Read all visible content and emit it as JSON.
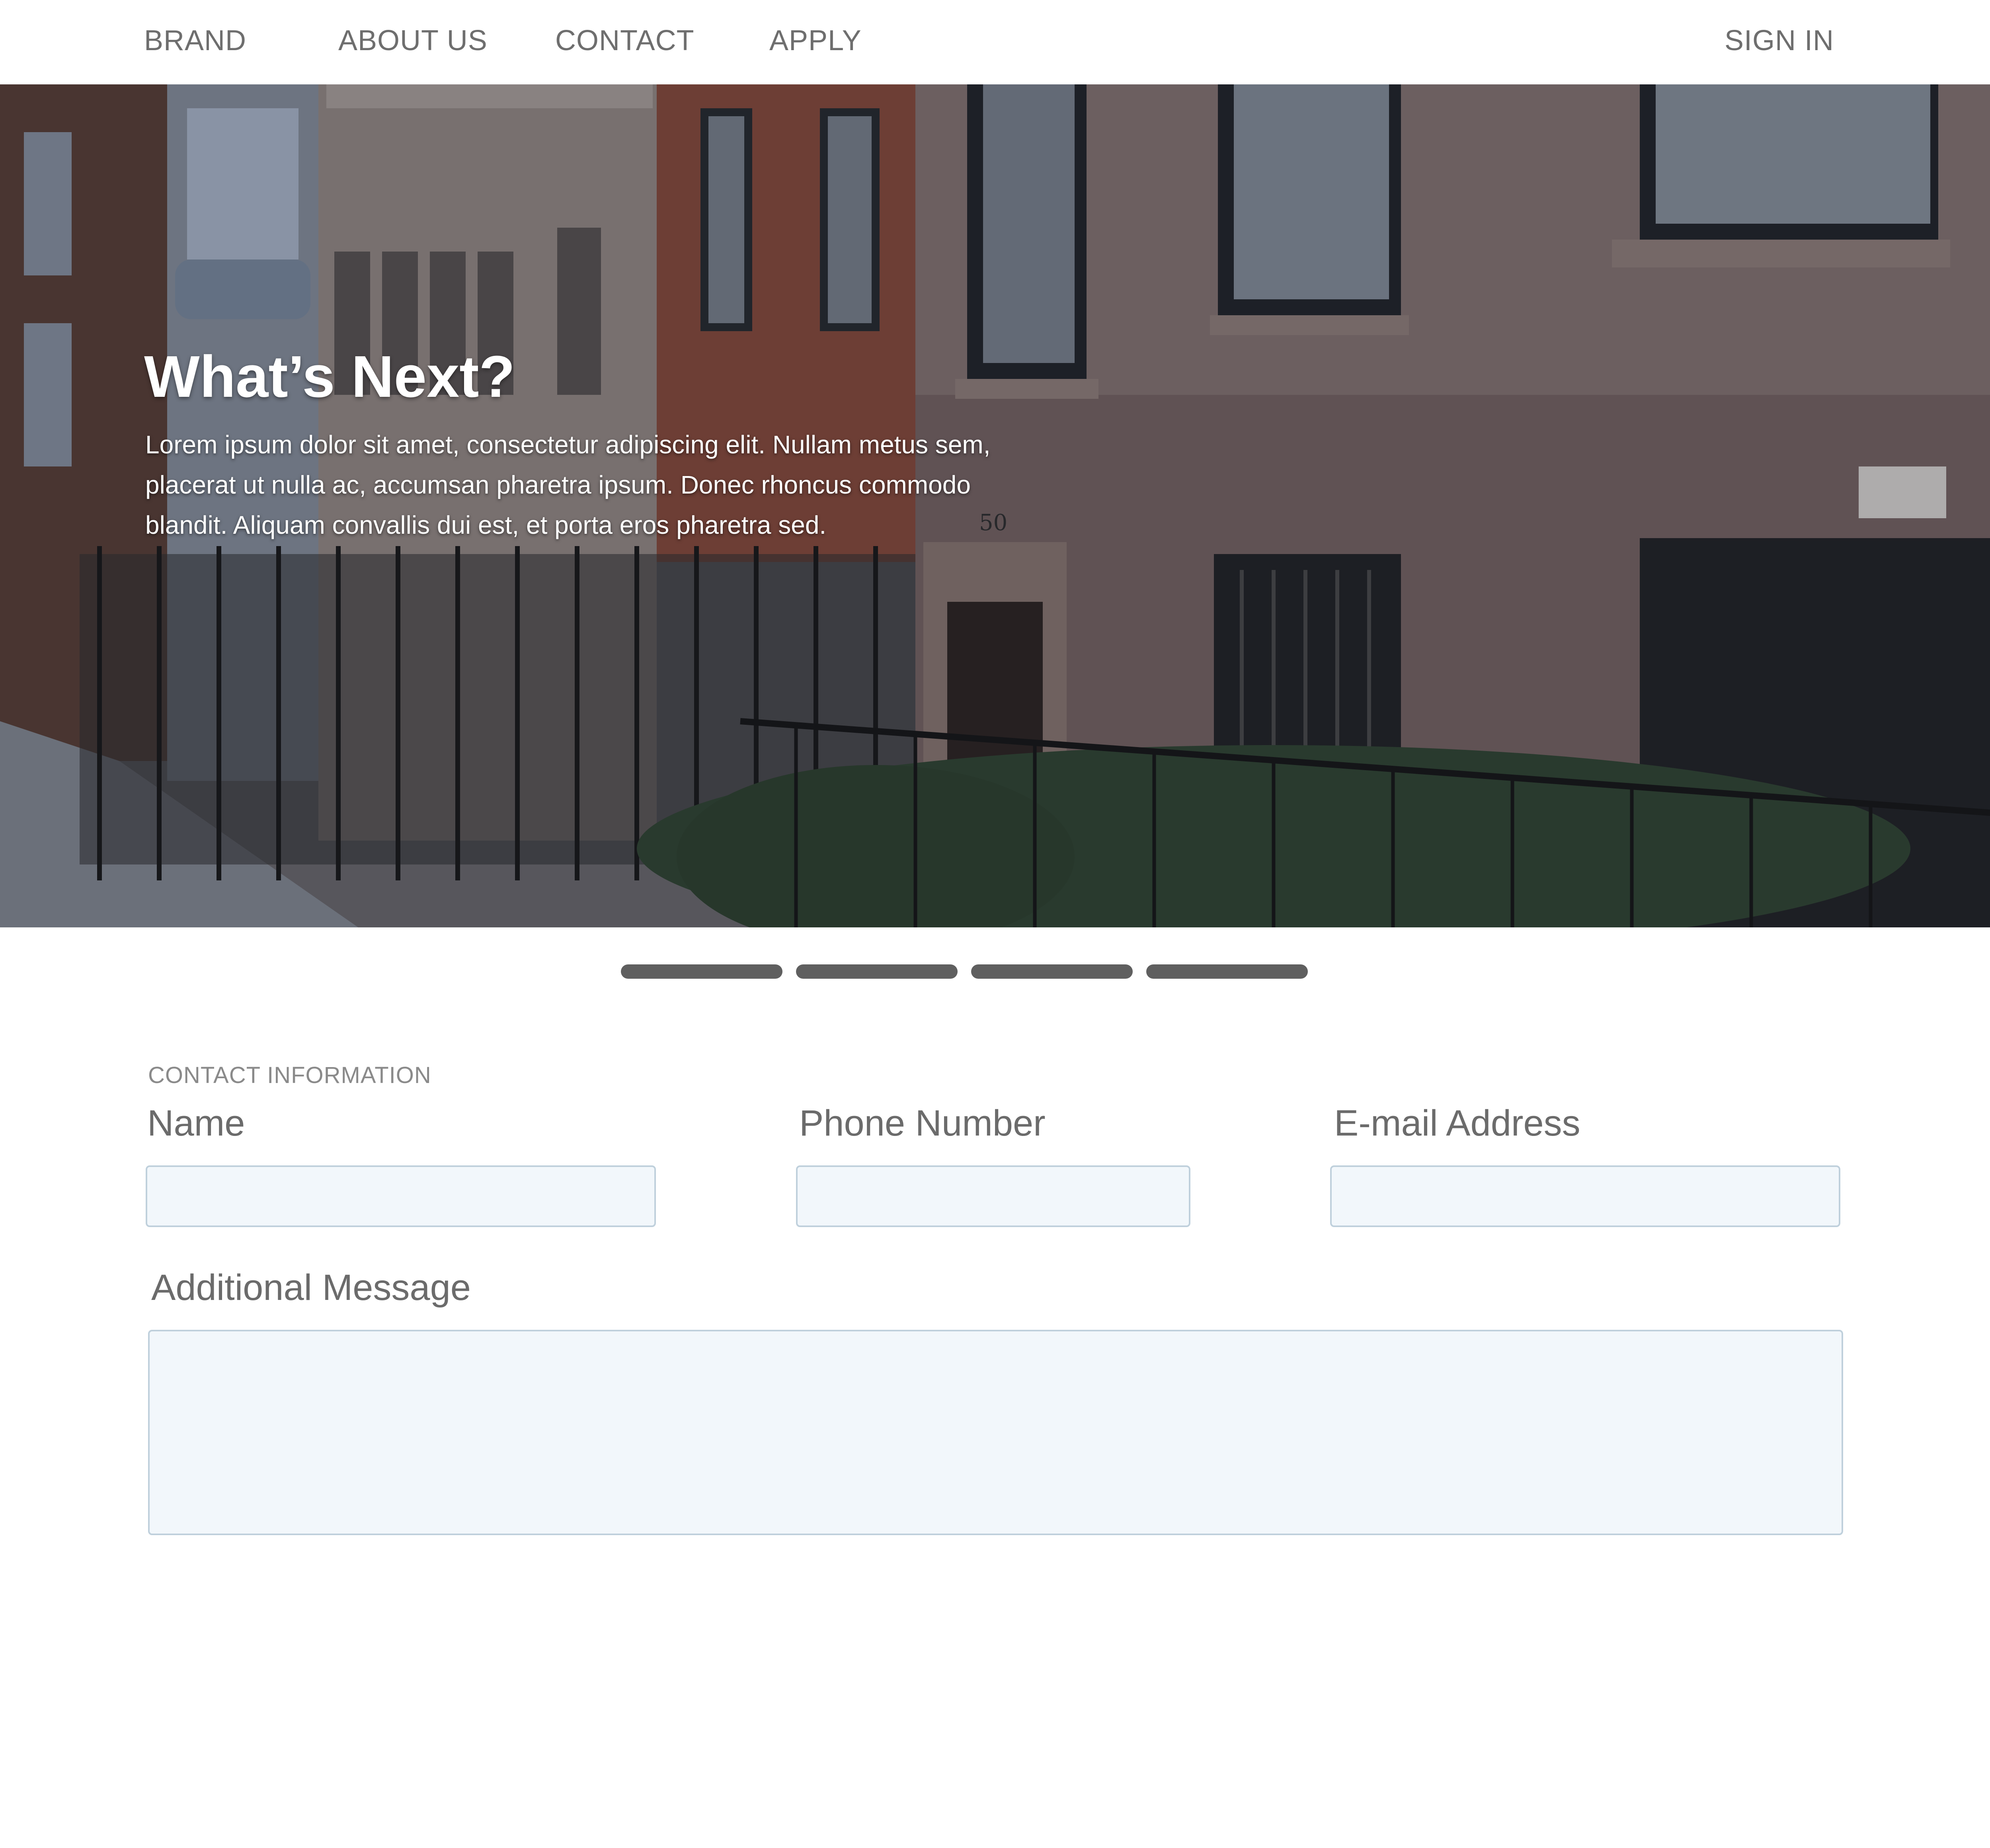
{
  "nav": {
    "brand": "BRAND",
    "about": "ABOUT US",
    "contact": "CONTACT",
    "apply": "APPLY",
    "sign_in": "SIGN IN"
  },
  "hero": {
    "title": "What’s Next?",
    "body": "Lorem ipsum dolor sit amet, consectetur adipiscing elit. Nullam metus sem, placerat ut nulla ac, accumsan pharetra ipsum. Donec rhoncus commodo blandit. Aliquam convallis dui est, et porta eros pharetra sed.",
    "building_number": "50"
  },
  "carousel": {
    "slide_count": 4
  },
  "form": {
    "section_label": "CONTACT INFORMATION",
    "name_label": "Name",
    "name_value": "",
    "phone_label": "Phone Number",
    "phone_value": "",
    "email_label": "E-mail Address",
    "email_value": "",
    "message_label": "Additional Message",
    "message_value": ""
  },
  "colors": {
    "nav_text": "#6e6e6e",
    "indicator": "#5f5f5f",
    "field_bg": "#f2f7fb",
    "field_border": "#bfd0dc"
  }
}
